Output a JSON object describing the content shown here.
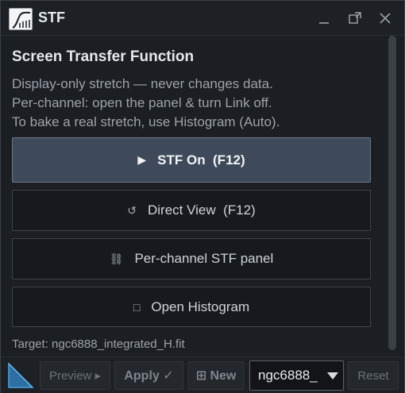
{
  "window": {
    "title": "STF",
    "icons": {
      "app": "stf-curve-icon",
      "minimize": "minimize-icon",
      "restore": "restore-icon",
      "close": "close-icon"
    }
  },
  "panel": {
    "heading": "Screen Transfer Function",
    "description_lines": [
      "Display-only stretch — never changes data.",
      "Per-channel: open the panel & turn Link off.",
      "To bake a real stretch, use Histogram (Auto)."
    ],
    "buttons": {
      "stf_on": {
        "icon": "▶",
        "label": "STF On  (F12)"
      },
      "direct_view": {
        "icon": "↺",
        "label": "Direct View  (F12)"
      },
      "per_channel": {
        "icon": "⛓",
        "label": "Per-channel STF panel"
      },
      "open_histogram": {
        "icon": "□",
        "label": "Open Histogram"
      }
    },
    "target": "Target: ngc6888_integrated_H.fit"
  },
  "bottom_bar": {
    "preview_label": "Preview ▸",
    "apply_label": "Apply ✓",
    "new_label": "⊞ New",
    "image_select_value": "ngc6888_",
    "reset_label": "Reset"
  },
  "colors": {
    "accent": "#3e4a5a",
    "window_bg": "#1b1e22",
    "corner_icon_blue": "#4aa3df"
  }
}
